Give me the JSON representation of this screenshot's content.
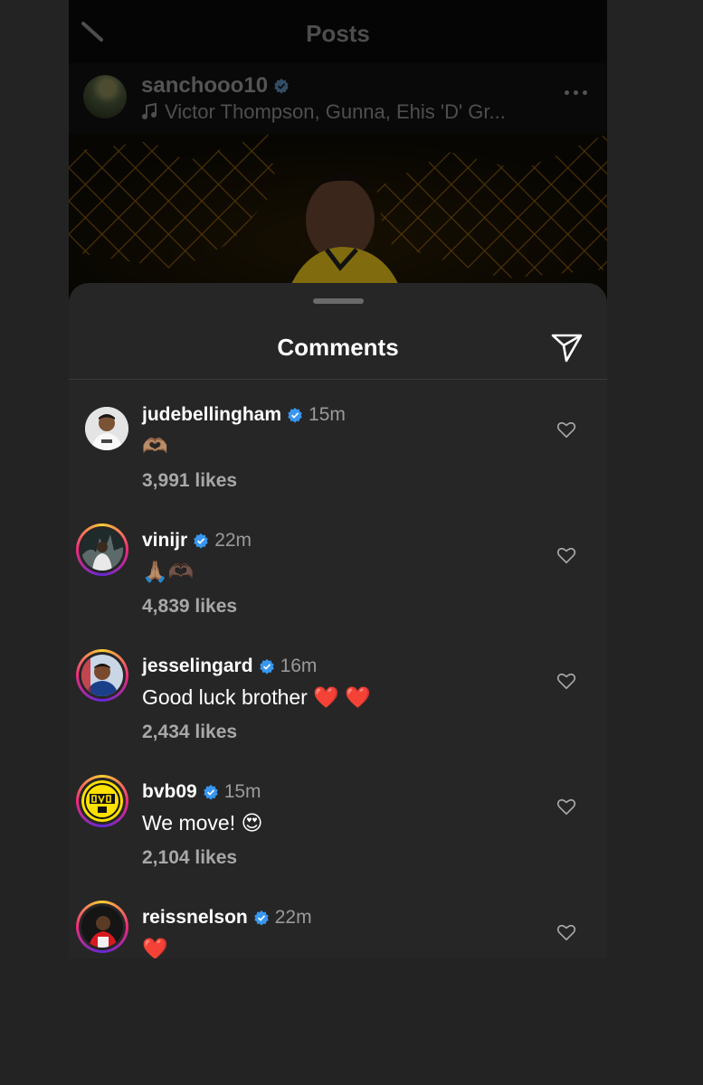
{
  "topbar": {
    "title": "Posts"
  },
  "post": {
    "username": "sanchooo10",
    "music": "Victor Thompson, Gunna, Ehis 'D' Gr..."
  },
  "sheet": {
    "title": "Comments"
  },
  "comments": [
    {
      "username": "judebellingham",
      "time": "15m",
      "text": "🫶🏽",
      "likes": "3,991 likes"
    },
    {
      "username": "vinijr",
      "time": "22m",
      "text": "🙏🏽🫶🏿",
      "likes": "4,839 likes"
    },
    {
      "username": "jesselingard",
      "time": "16m",
      "text": "Good luck brother ❤️ ❤️",
      "likes": "2,434 likes"
    },
    {
      "username": "bvb09",
      "time": "15m",
      "text": "We move! 😍",
      "likes": "2,104 likes"
    },
    {
      "username": "reissnelson",
      "time": "22m",
      "text": "❤️",
      "likes": ""
    }
  ],
  "colors": {
    "sheet_bg": "#262626",
    "verified_blue": "#3897f0",
    "story_ring": "#ee2a7b",
    "bvb_yellow": "#fde100"
  },
  "icons": [
    "back-icon",
    "verified-icon",
    "music-note-icon",
    "more-icon",
    "share-icon",
    "heart-icon"
  ]
}
